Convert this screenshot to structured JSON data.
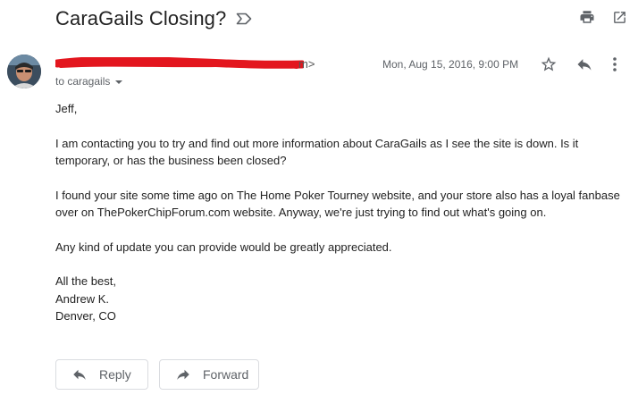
{
  "subject": "CaraGails Closing?",
  "sender": {
    "email_tail": "m>"
  },
  "recipients": {
    "label": "to caragails"
  },
  "date": "Mon, Aug 15, 2016, 9:00 PM",
  "body": {
    "greeting": "Jeff,",
    "para1": "I am contacting you to try and find out more information about CaraGails as I see the site is down. Is it temporary, or has the business been closed?",
    "para2": "I found your site some time ago on The Home Poker Tourney website, and your store also has a loyal fanbase over on ThePokerChipForum.com website. Anyway, we're just trying to find out what's going on.",
    "para3": "Any kind of update you can provide would be greatly appreciated.",
    "closing": "All the best,",
    "name": "Andrew K.",
    "location": "Denver, CO"
  },
  "actions": {
    "reply_label": "Reply",
    "forward_label": "Forward"
  },
  "icons": {
    "label": "label-outline-icon",
    "print": "print-icon",
    "open_new_window": "open-in-new-icon",
    "star": "star-outline-icon",
    "reply": "reply-icon",
    "more": "more-vert-icon",
    "forward": "forward-icon"
  },
  "colors": {
    "redaction": "#e3161e",
    "text": "#222222",
    "muted": "#5f6368",
    "icon": "#5f6368"
  }
}
